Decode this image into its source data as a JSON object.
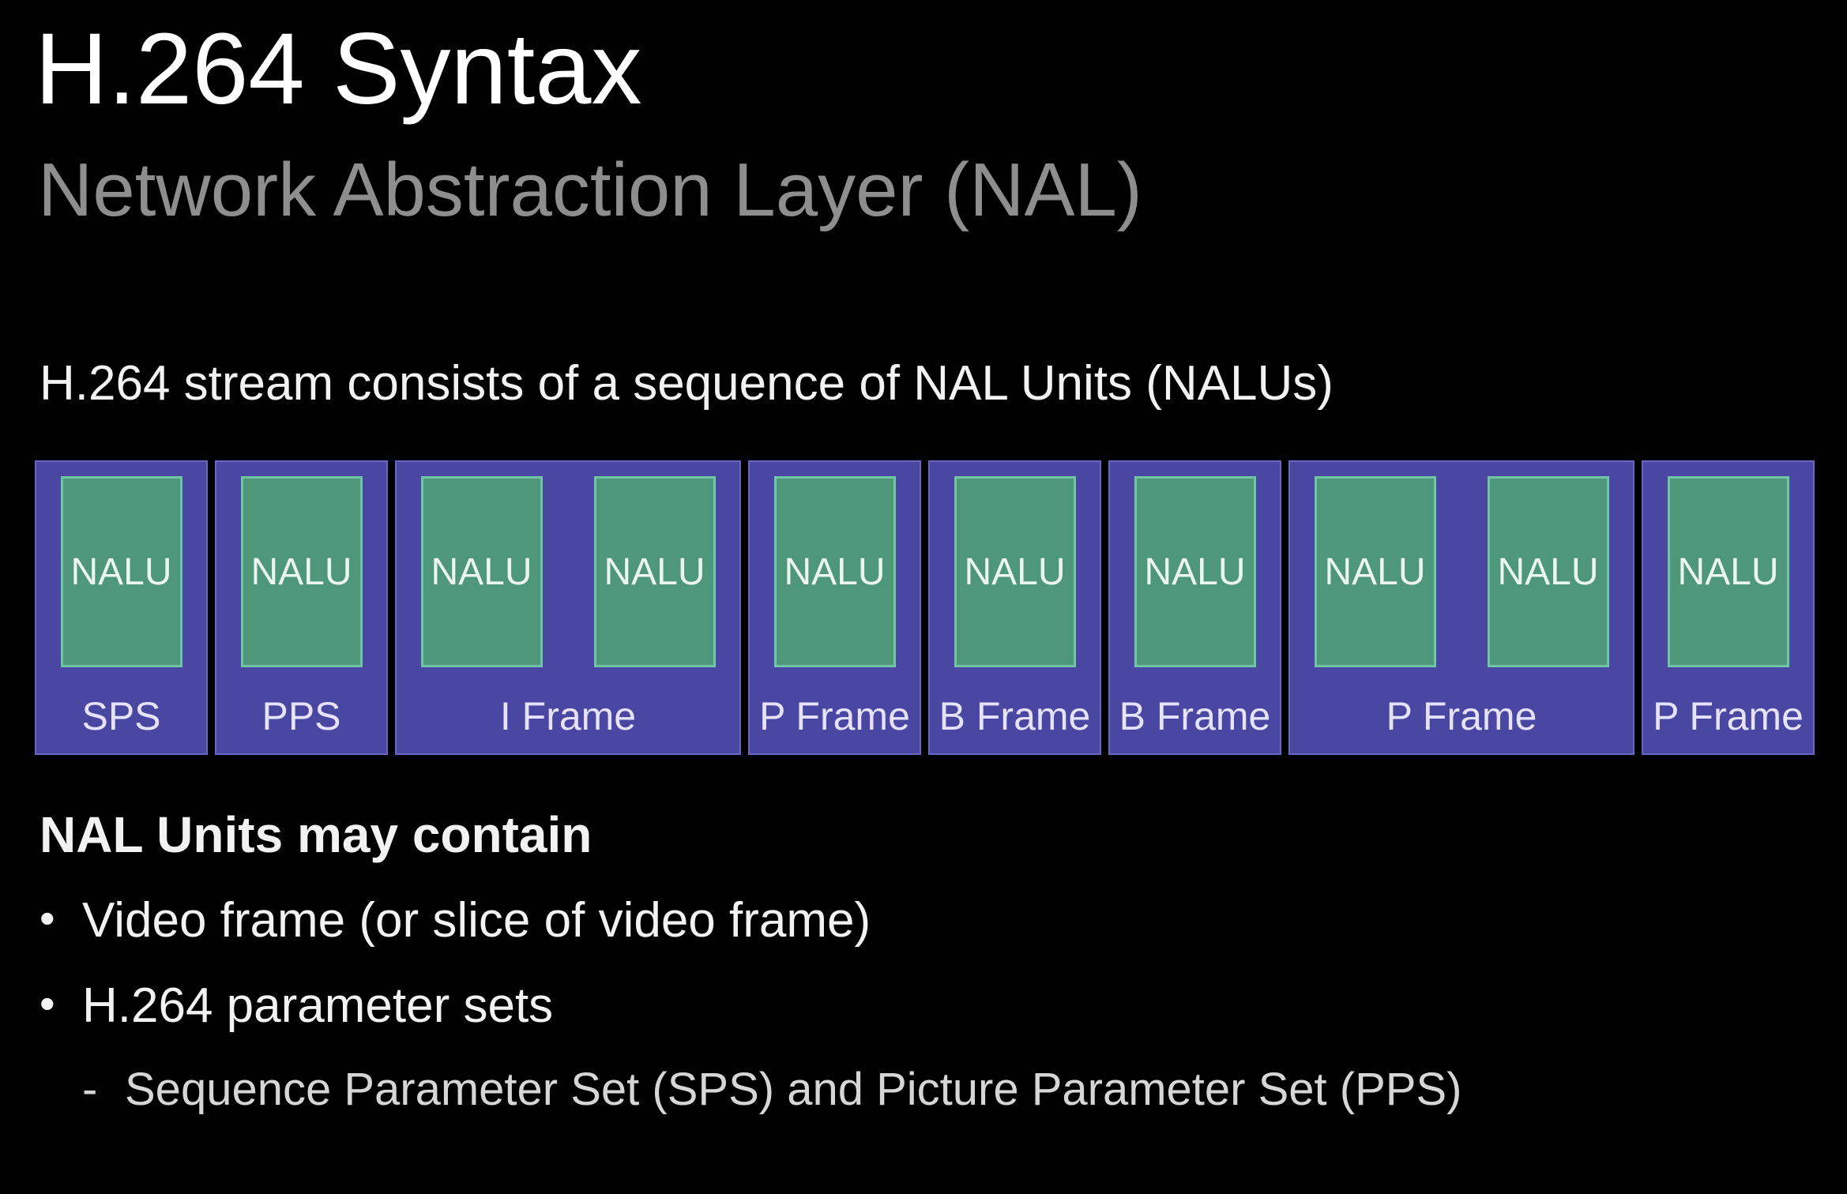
{
  "slide": {
    "title": "H.264 Syntax",
    "subtitle": "Network Abstraction Layer (NAL)",
    "intro": "H.264 stream consists of a sequence of NAL Units (NALUs)"
  },
  "stream": {
    "groups": [
      {
        "label": "SPS",
        "nalus": [
          "NALU"
        ]
      },
      {
        "label": "PPS",
        "nalus": [
          "NALU"
        ]
      },
      {
        "label": "I Frame",
        "nalus": [
          "NALU",
          "NALU"
        ]
      },
      {
        "label": "P Frame",
        "nalus": [
          "NALU"
        ]
      },
      {
        "label": "B Frame",
        "nalus": [
          "NALU"
        ]
      },
      {
        "label": "B Frame",
        "nalus": [
          "NALU"
        ]
      },
      {
        "label": "P Frame",
        "nalus": [
          "NALU",
          "NALU"
        ]
      },
      {
        "label": "P Frame",
        "nalus": [
          "NALU"
        ]
      }
    ],
    "colors": {
      "frame_fill": "#4a47a3",
      "frame_border": "#6a67c2",
      "nalu_fill": "#4f977b",
      "nalu_border": "#6fc6a4"
    }
  },
  "contents": {
    "heading": "NAL Units may contain",
    "bullets": [
      "Video frame (or slice of video frame)",
      "H.264 parameter sets"
    ],
    "sub_bullets": [
      "Sequence Parameter Set (SPS) and Picture Parameter Set (PPS)"
    ],
    "bullet_marker": "•",
    "sub_marker": "-"
  }
}
